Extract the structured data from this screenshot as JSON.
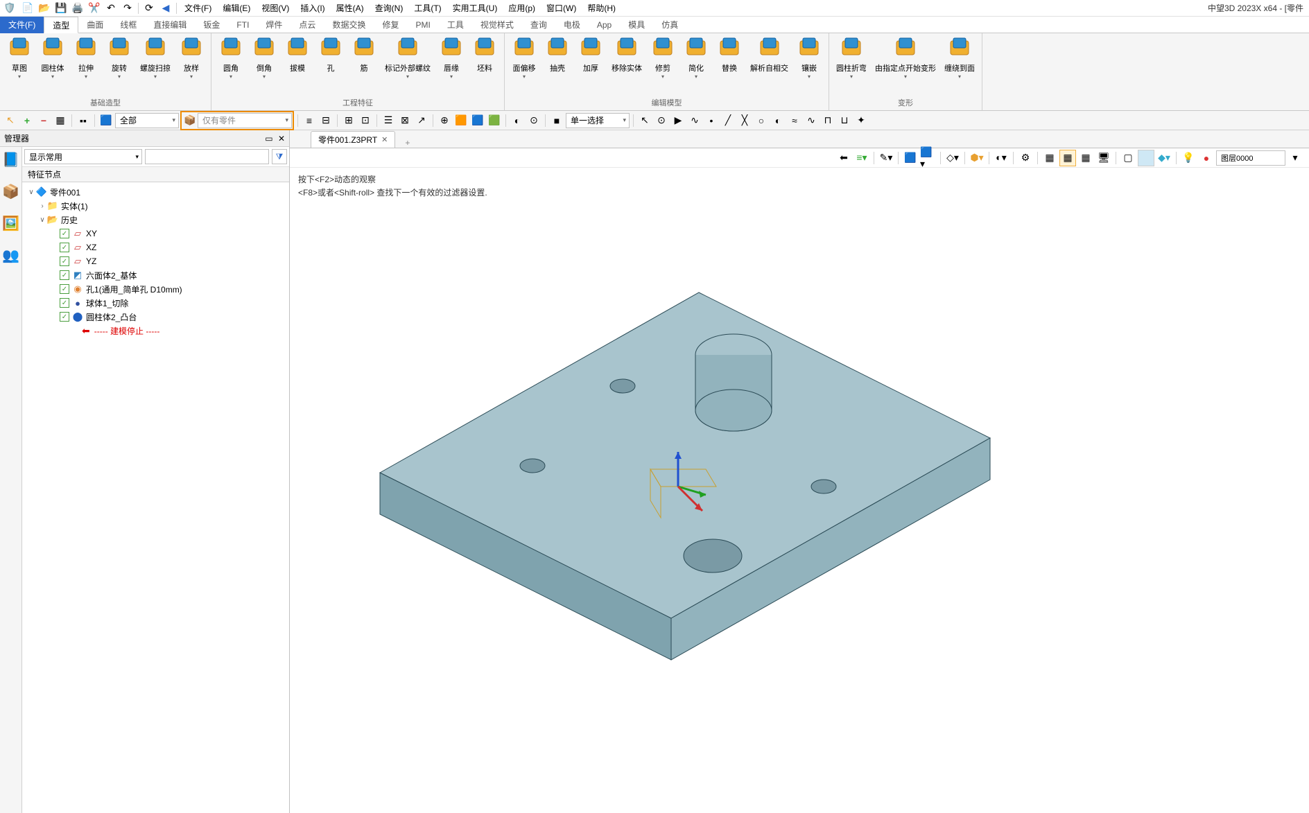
{
  "app_title": "中望3D 2023X x64 - [零件",
  "menus": [
    "文件(F)",
    "编辑(E)",
    "视图(V)",
    "插入(I)",
    "属性(A)",
    "查询(N)",
    "工具(T)",
    "实用工具(U)",
    "应用(p)",
    "窗口(W)",
    "帮助(H)"
  ],
  "ribbon_tabs": {
    "primary": "文件(F)",
    "tabs": [
      "造型",
      "曲面",
      "线框",
      "直接编辑",
      "钣金",
      "FTI",
      "焊件",
      "点云",
      "数据交换",
      "修复",
      "PMI",
      "工具",
      "视觉样式",
      "查询",
      "电极",
      "App",
      "模具",
      "仿真"
    ],
    "active": "造型"
  },
  "ribbon_groups": [
    {
      "label": "基础造型",
      "items": [
        {
          "label": "草图",
          "caret": true
        },
        {
          "label": "圆柱体",
          "caret": true
        },
        {
          "label": "拉伸",
          "caret": true
        },
        {
          "label": "旋转",
          "caret": true
        },
        {
          "label": "螺旋扫掠",
          "caret": true
        },
        {
          "label": "放样",
          "caret": true
        }
      ]
    },
    {
      "label": "工程特征",
      "items": [
        {
          "label": "圆角",
          "caret": true
        },
        {
          "label": "倒角",
          "caret": true
        },
        {
          "label": "拔模",
          "caret": false
        },
        {
          "label": "孔",
          "caret": false
        },
        {
          "label": "筋",
          "caret": false
        },
        {
          "label": "标记外部螺纹",
          "caret": true
        },
        {
          "label": "唇缘",
          "caret": true
        },
        {
          "label": "坯料",
          "caret": false
        }
      ]
    },
    {
      "label": "编辑模型",
      "items": [
        {
          "label": "面偏移",
          "caret": true
        },
        {
          "label": "抽壳",
          "caret": false
        },
        {
          "label": "加厚",
          "caret": false
        },
        {
          "label": "移除实体",
          "caret": false
        },
        {
          "label": "修剪",
          "caret": true
        },
        {
          "label": "简化",
          "caret": true
        },
        {
          "label": "替换",
          "caret": false
        },
        {
          "label": "解析自相交",
          "caret": false
        },
        {
          "label": "镶嵌",
          "caret": true
        }
      ]
    },
    {
      "label": "变形",
      "items": [
        {
          "label": "圆柱折弯",
          "caret": true
        },
        {
          "label": "由指定点开始变形",
          "caret": true
        },
        {
          "label": "缠绕到面",
          "caret": true
        }
      ]
    }
  ],
  "secondary": {
    "combo1": "全部",
    "combo2": "仅有零件",
    "combo3": "单一选择"
  },
  "manager": {
    "title": "管理器",
    "filter_label": "显示常用",
    "section": "特征节点",
    "tree": {
      "root": "零件001",
      "entity_folder": "实体(1)",
      "history": "历史",
      "nodes": [
        {
          "icon": "plane",
          "label": "XY"
        },
        {
          "icon": "plane",
          "label": "XZ"
        },
        {
          "icon": "plane",
          "label": "YZ"
        },
        {
          "icon": "cube",
          "label": "六面体2_基体"
        },
        {
          "icon": "hole",
          "label": "孔1(通用_简单孔 D10mm)"
        },
        {
          "icon": "sphere",
          "label": "球体1_切除"
        },
        {
          "icon": "cyl",
          "label": "圆柱体2_凸台"
        }
      ],
      "stop_text": "----- 建模停止 -----"
    }
  },
  "doc_tab": "零件001.Z3PRT",
  "hints": {
    "line1": "按下<F2>动态的观察",
    "line2": "<F8>或者<Shift-roll> 查找下一个有效的过滤器设置."
  },
  "layer_label": "图层0000"
}
